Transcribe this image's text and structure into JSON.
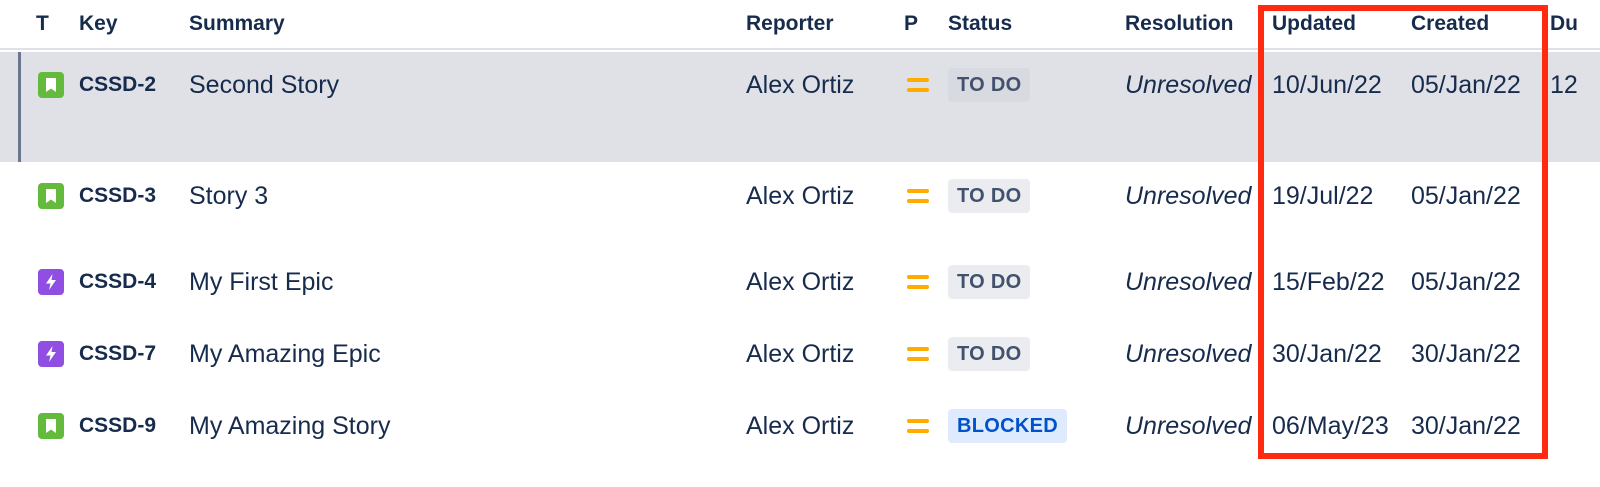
{
  "columns": {
    "type": "T",
    "key": "Key",
    "summary": "Summary",
    "reporter": "Reporter",
    "priority": "P",
    "status": "Status",
    "resolution": "Resolution",
    "updated": "Updated",
    "created": "Created",
    "due": "Du"
  },
  "rows": [
    {
      "type": "story",
      "type_icon": "story-icon",
      "key": "CSSD-2",
      "summary": "Second Story",
      "reporter": "Alex Ortiz",
      "priority": "medium",
      "status": "TO DO",
      "resolution": "Unresolved",
      "updated": "10/Jun/22",
      "created": "05/Jan/22",
      "due": "12",
      "selected": true
    },
    {
      "type": "story",
      "type_icon": "story-icon",
      "key": "CSSD-3",
      "summary": "Story 3",
      "reporter": "Alex Ortiz",
      "priority": "medium",
      "status": "TO DO",
      "resolution": "Unresolved",
      "updated": "19/Jul/22",
      "created": "05/Jan/22",
      "due": ""
    },
    {
      "type": "epic",
      "type_icon": "epic-icon",
      "key": "CSSD-4",
      "summary": "My First Epic",
      "reporter": "Alex Ortiz",
      "priority": "medium",
      "status": "TO DO",
      "resolution": "Unresolved",
      "updated": "15/Feb/22",
      "created": "05/Jan/22",
      "due": ""
    },
    {
      "type": "epic",
      "type_icon": "epic-icon",
      "key": "CSSD-7",
      "summary": "My Amazing Epic",
      "reporter": "Alex Ortiz",
      "priority": "medium",
      "status": "TO DO",
      "resolution": "Unresolved",
      "updated": "30/Jan/22",
      "created": "30/Jan/22",
      "due": ""
    },
    {
      "type": "story",
      "type_icon": "story-icon",
      "key": "CSSD-9",
      "summary": "My Amazing Story",
      "reporter": "Alex Ortiz",
      "priority": "medium",
      "status": "BLOCKED",
      "resolution": "Unresolved",
      "updated": "06/May/23",
      "created": "30/Jan/22",
      "due": ""
    }
  ],
  "colors": {
    "story": "#63ba3c",
    "epic": "#904ee2",
    "priority_medium": "#ffab00",
    "highlight": "#ff2a0f",
    "blocked_text": "#0052cc"
  }
}
